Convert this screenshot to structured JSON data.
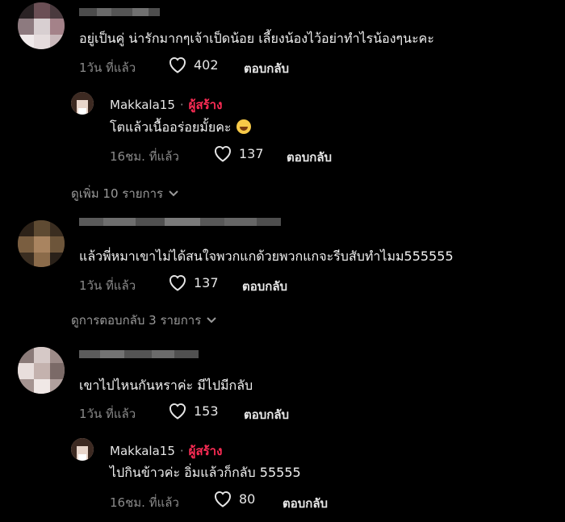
{
  "comments": [
    {
      "text": "อยู่เป็นคู่ น่ารักมากๆเจ้าเป็ดน้อย เลี้ยงน้องไว้อย่าทำไรน้องๆนะคะ",
      "time": "1วัน ที่แล้ว",
      "likes": "402",
      "reply_label": "ตอบกลับ",
      "reply": {
        "author": "Makkala15",
        "separator": "·",
        "badge": "ผู้สร้าง",
        "text": "โตแล้วเนื้ออร่อยมั้ยคะ",
        "emoji": "rolling-on-floor-laughing-emoji",
        "time": "16ชม. ที่แล้ว",
        "likes": "137",
        "reply_label": "ตอบกลับ"
      },
      "more_label": "ดูเพิ่ม 10 รายการ"
    },
    {
      "text": "แล้วพี่หมาเขาไม่ได้สนใจพวกแกด้วยพวกแกจะรีบสับทำไมม555555",
      "time": "1วัน ที่แล้ว",
      "likes": "137",
      "reply_label": "ตอบกลับ",
      "more_label": "ดูการตอบกลับ 3 รายการ"
    },
    {
      "text": "เขาไปไหนกันหราค่ะ มีไปมีกลับ",
      "time": "1วัน ที่แล้ว",
      "likes": "153",
      "reply_label": "ตอบกลับ",
      "reply": {
        "author": "Makkala15",
        "separator": "·",
        "badge": "ผู้สร้าง",
        "text": "ไปกินข้าวค่ะ อิ่มแล้วก็กลับ 55555",
        "time": "16ชม. ที่แล้ว",
        "likes": "80",
        "reply_label": "ตอบกลับ"
      }
    }
  ],
  "colors": {
    "background": "#000000",
    "creator_badge": "#fe2c55",
    "meta_text": "#8a8a8a"
  },
  "icons": [
    "heart-outline-icon",
    "chevron-down-icon"
  ]
}
